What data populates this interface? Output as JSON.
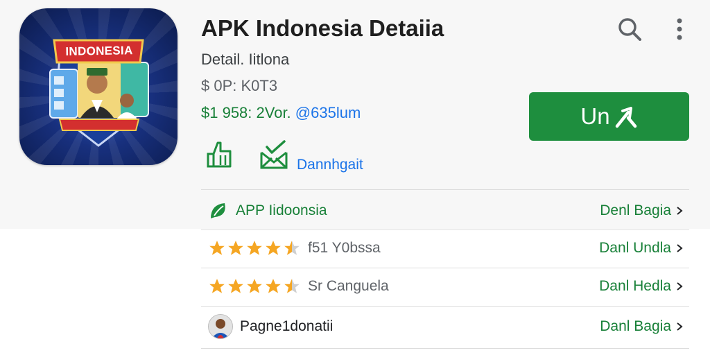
{
  "app": {
    "icon_banner_text": "INDONESIA",
    "title": "APK Indonesia Detaiia",
    "subtitle": "Detail. Iitlona",
    "meta": "$ 0P: K0T3",
    "price_prefix": "$1 958: 2Vor. ",
    "price_link": "@635lum"
  },
  "toolbar": {
    "search_icon": "search-icon",
    "more_icon": "more-vert-icon"
  },
  "install_button": {
    "label": "Un",
    "icon": "arrow-icon",
    "color": "#1e8e3e"
  },
  "actions": {
    "icon1": "like-hand-icon",
    "icon2": "download-envelope-icon",
    "download_label": "Dannhgait"
  },
  "rows": [
    {
      "icon": "leaf-icon",
      "label": "APP Iidoonsia",
      "link": "Denl Bagia",
      "rating": null
    },
    {
      "label": "f51 Y0bssa",
      "link": "Danl Undla",
      "rating": 4.5
    },
    {
      "label": "Sr Canguela",
      "link": "Danl Hedla",
      "rating": 4.5
    },
    {
      "icon": "avatar",
      "label": "Pagne1donatii",
      "link": "Danl Bagia",
      "rating": null
    }
  ],
  "colors": {
    "accent_green": "#1e8e3e",
    "link_green": "#188038",
    "link_blue": "#1a73e8",
    "star": "#f5a623"
  }
}
